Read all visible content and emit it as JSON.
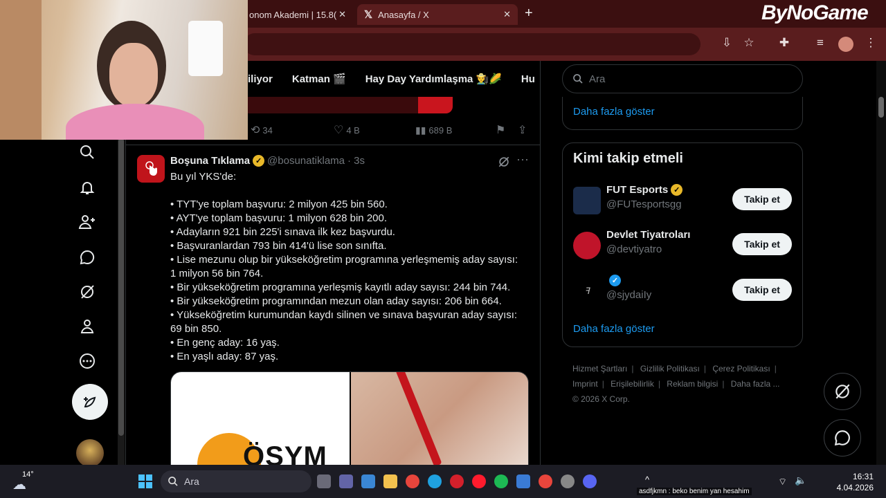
{
  "browser": {
    "tabs": [
      {
        "label": "onom Akademi | 15.8("
      },
      {
        "label": "Anasayfa / X"
      }
    ],
    "brand_overlay": "ByNoGame"
  },
  "x_nav_tabs": [
    "iliyor",
    "Katman 🎬",
    "Hay Day Yardımlaşma 👨‍🌾🌽",
    "Hu"
  ],
  "prev_tweet_actions": {
    "retweets": "34",
    "likes": "4 B",
    "views": "689 B"
  },
  "tweet": {
    "name": "Boşuna Tıklama",
    "handle": "@bosunatiklama",
    "time": "· 3s",
    "lines": [
      "Bu yıl YKS'de:",
      "",
      "• TYT'ye toplam başvuru: 2 milyon 425 bin 560.",
      "• AYT'ye toplam başvuru: 1 milyon 628 bin 200.",
      "• Adayların 921 bin 225'i sınava ilk kez başvurdu.",
      "• Başvuranlardan 793 bin 414'ü lise son sınıfta.",
      "• Lise mezunu olup bir yükseköğretim programına yerleşmemiş aday sayısı:",
      "1 milyon 56 bin 764.",
      "• Bir yükseköğretim programına yerleşmiş kayıtlı aday sayısı: 244 bin 744.",
      "• Bir yükseköğretim programından mezun olan aday sayısı: 206 bin 664.",
      "• Yükseköğretim kurumundan kaydı silinen ve sınava başvuran aday sayısı:",
      "69 bin 850.",
      "• En genç aday: 16 yaş.",
      "• En yaşlı aday: 87 yaş."
    ],
    "media_text": "ÖSYM"
  },
  "search": {
    "placeholder": "Ara"
  },
  "right": {
    "show_more": "Daha fazla göster",
    "wtf_title": "Kimi takip etmeli",
    "follow_label": "Takip et",
    "suggestions": [
      {
        "name": "FUT Esports",
        "handle": "@FUTesportsgg"
      },
      {
        "name": "Devlet Tiyatroları",
        "handle": "@devtiyatro"
      },
      {
        "name": "",
        "handle": "@sjydaiIy"
      }
    ],
    "footer": [
      "Hizmet Şartları",
      "Gizlilik Politikası",
      "Çerez Politikası",
      "Imprint",
      "Erişilebilirlik",
      "Reklam bilgisi",
      "Daha fazla ...",
      "© 2026 X Corp."
    ]
  },
  "taskbar": {
    "temperature": "14°",
    "search_label": "Ara",
    "time": "16:31",
    "date": "4.04.2026",
    "chat_overlay": "asdfjkmn : beko benim yan hesahim"
  },
  "colors": {
    "accent": "#1d9bf0",
    "gold": "#e8b829",
    "chrome": "#5a1d1e"
  }
}
